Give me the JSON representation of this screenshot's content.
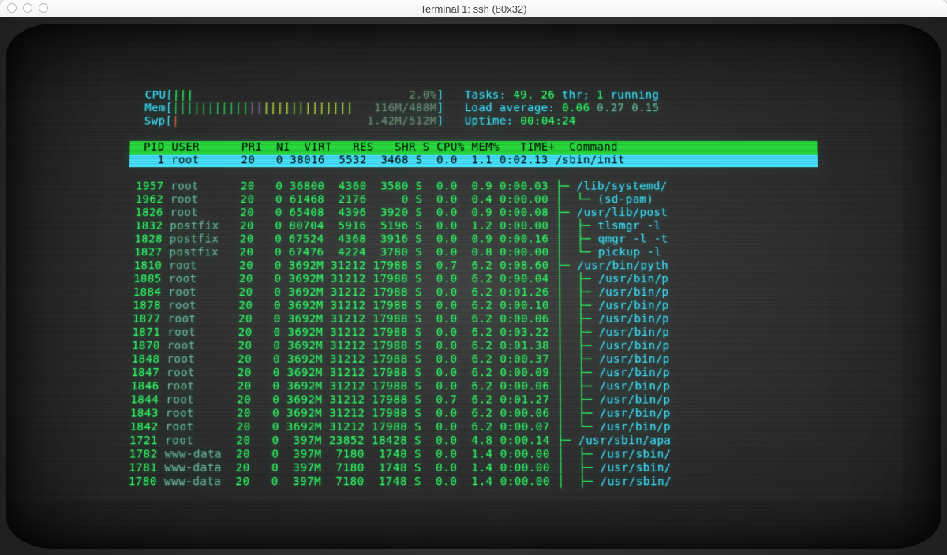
{
  "window": {
    "title": "Terminal 1: ssh (80x32)"
  },
  "meters": {
    "cpu": {
      "label": "CPU",
      "bar": "|||",
      "value": "2.0%"
    },
    "mem": {
      "label": "Mem",
      "bar": "||||||||||||||||||||||||||",
      "value": "116M/488M"
    },
    "swp": {
      "label": "Swp",
      "bar": "|",
      "value": "1.42M/512M"
    },
    "tasks": {
      "label": "Tasks:",
      "value": "49, 26 thr; 1 running"
    },
    "loadavg": {
      "label": "Load average:",
      "value": "0.06 0.27 0.15"
    },
    "uptime": {
      "label": "Uptime:",
      "value": "00:04:24"
    }
  },
  "columns": "  PID USER      PRI  NI  VIRT   RES   SHR S CPU% MEM%   TIME+  Command",
  "selected": {
    "pid": "1",
    "user": "root",
    "pri": "20",
    "ni": "0",
    "virt": "38016",
    "res": "5532",
    "shr": "3468",
    "s": "S",
    "cpu": "0.0",
    "mem": "1.1",
    "time": "0:02.13",
    "cmd": "/sbin/init"
  },
  "rows": [
    {
      "pid": "1957",
      "user": "root",
      "pri": "20",
      "ni": "0",
      "virt": "36800",
      "res": "4360",
      "shr": "3580",
      "s": "S",
      "cpu": "0.0",
      "mem": "0.9",
      "time": "0:00.03",
      "tree": "├─ ",
      "cmd": "/lib/systemd/"
    },
    {
      "pid": "1962",
      "user": "root",
      "pri": "20",
      "ni": "0",
      "virt": "61468",
      "res": "2176",
      "shr": "0",
      "s": "S",
      "cpu": "0.0",
      "mem": "0.4",
      "time": "0:00.00",
      "tree": "│  └─ ",
      "cmd": "(sd-pam)"
    },
    {
      "pid": "1826",
      "user": "root",
      "pri": "20",
      "ni": "0",
      "virt": "65408",
      "res": "4396",
      "shr": "3920",
      "s": "S",
      "cpu": "0.0",
      "mem": "0.9",
      "time": "0:00.08",
      "tree": "├─ ",
      "cmd": "/usr/lib/post"
    },
    {
      "pid": "1832",
      "user": "postfix",
      "pri": "20",
      "ni": "0",
      "virt": "80704",
      "res": "5916",
      "shr": "5196",
      "s": "S",
      "cpu": "0.0",
      "mem": "1.2",
      "time": "0:00.00",
      "tree": "│  ├─ ",
      "cmd": "tlsmgr -l"
    },
    {
      "pid": "1828",
      "user": "postfix",
      "pri": "20",
      "ni": "0",
      "virt": "67524",
      "res": "4368",
      "shr": "3916",
      "s": "S",
      "cpu": "0.0",
      "mem": "0.9",
      "time": "0:00.16",
      "tree": "│  ├─ ",
      "cmd": "qmgr -l -t"
    },
    {
      "pid": "1827",
      "user": "postfix",
      "pri": "20",
      "ni": "0",
      "virt": "67476",
      "res": "4224",
      "shr": "3780",
      "s": "S",
      "cpu": "0.0",
      "mem": "0.8",
      "time": "0:00.00",
      "tree": "│  └─ ",
      "cmd": "pickup -l"
    },
    {
      "pid": "1810",
      "user": "root",
      "pri": "20",
      "ni": "0",
      "virt": "3692M",
      "res": "31212",
      "shr": "17988",
      "s": "S",
      "cpu": "0.7",
      "mem": "6.2",
      "time": "0:08.60",
      "tree": "├─ ",
      "cmd": "/usr/bin/pyth"
    },
    {
      "pid": "1885",
      "user": "root",
      "pri": "20",
      "ni": "0",
      "virt": "3692M",
      "res": "31212",
      "shr": "17988",
      "s": "S",
      "cpu": "0.0",
      "mem": "6.2",
      "time": "0:00.04",
      "tree": "│  ├─ ",
      "cmd": "/usr/bin/p"
    },
    {
      "pid": "1884",
      "user": "root",
      "pri": "20",
      "ni": "0",
      "virt": "3692M",
      "res": "31212",
      "shr": "17988",
      "s": "S",
      "cpu": "0.0",
      "mem": "6.2",
      "time": "0:01.26",
      "tree": "│  ├─ ",
      "cmd": "/usr/bin/p"
    },
    {
      "pid": "1878",
      "user": "root",
      "pri": "20",
      "ni": "0",
      "virt": "3692M",
      "res": "31212",
      "shr": "17988",
      "s": "S",
      "cpu": "0.0",
      "mem": "6.2",
      "time": "0:00.10",
      "tree": "│  ├─ ",
      "cmd": "/usr/bin/p"
    },
    {
      "pid": "1877",
      "user": "root",
      "pri": "20",
      "ni": "0",
      "virt": "3692M",
      "res": "31212",
      "shr": "17988",
      "s": "S",
      "cpu": "0.0",
      "mem": "6.2",
      "time": "0:00.06",
      "tree": "│  ├─ ",
      "cmd": "/usr/bin/p"
    },
    {
      "pid": "1871",
      "user": "root",
      "pri": "20",
      "ni": "0",
      "virt": "3692M",
      "res": "31212",
      "shr": "17988",
      "s": "S",
      "cpu": "0.0",
      "mem": "6.2",
      "time": "0:03.22",
      "tree": "│  ├─ ",
      "cmd": "/usr/bin/p"
    },
    {
      "pid": "1870",
      "user": "root",
      "pri": "20",
      "ni": "0",
      "virt": "3692M",
      "res": "31212",
      "shr": "17988",
      "s": "S",
      "cpu": "0.0",
      "mem": "6.2",
      "time": "0:01.38",
      "tree": "│  ├─ ",
      "cmd": "/usr/bin/p"
    },
    {
      "pid": "1848",
      "user": "root",
      "pri": "20",
      "ni": "0",
      "virt": "3692M",
      "res": "31212",
      "shr": "17988",
      "s": "S",
      "cpu": "0.0",
      "mem": "6.2",
      "time": "0:00.37",
      "tree": "│  ├─ ",
      "cmd": "/usr/bin/p"
    },
    {
      "pid": "1847",
      "user": "root",
      "pri": "20",
      "ni": "0",
      "virt": "3692M",
      "res": "31212",
      "shr": "17988",
      "s": "S",
      "cpu": "0.0",
      "mem": "6.2",
      "time": "0:00.09",
      "tree": "│  ├─ ",
      "cmd": "/usr/bin/p"
    },
    {
      "pid": "1846",
      "user": "root",
      "pri": "20",
      "ni": "0",
      "virt": "3692M",
      "res": "31212",
      "shr": "17988",
      "s": "S",
      "cpu": "0.0",
      "mem": "6.2",
      "time": "0:00.06",
      "tree": "│  ├─ ",
      "cmd": "/usr/bin/p"
    },
    {
      "pid": "1844",
      "user": "root",
      "pri": "20",
      "ni": "0",
      "virt": "3692M",
      "res": "31212",
      "shr": "17988",
      "s": "S",
      "cpu": "0.7",
      "mem": "6.2",
      "time": "0:01.27",
      "tree": "│  ├─ ",
      "cmd": "/usr/bin/p"
    },
    {
      "pid": "1843",
      "user": "root",
      "pri": "20",
      "ni": "0",
      "virt": "3692M",
      "res": "31212",
      "shr": "17988",
      "s": "S",
      "cpu": "0.0",
      "mem": "6.2",
      "time": "0:00.06",
      "tree": "│  ├─ ",
      "cmd": "/usr/bin/p"
    },
    {
      "pid": "1842",
      "user": "root",
      "pri": "20",
      "ni": "0",
      "virt": "3692M",
      "res": "31212",
      "shr": "17988",
      "s": "S",
      "cpu": "0.0",
      "mem": "6.2",
      "time": "0:00.07",
      "tree": "│  └─ ",
      "cmd": "/usr/bin/p"
    },
    {
      "pid": "1721",
      "user": "root",
      "pri": "20",
      "ni": "0",
      "virt": "397M",
      "res": "23852",
      "shr": "18428",
      "s": "S",
      "cpu": "0.0",
      "mem": "4.8",
      "time": "0:00.14",
      "tree": "├─ ",
      "cmd": "/usr/sbin/apa"
    },
    {
      "pid": "1782",
      "user": "www-data",
      "pri": "20",
      "ni": "0",
      "virt": "397M",
      "res": "7180",
      "shr": "1748",
      "s": "S",
      "cpu": "0.0",
      "mem": "1.4",
      "time": "0:00.00",
      "tree": "│  ├─ ",
      "cmd": "/usr/sbin/"
    },
    {
      "pid": "1781",
      "user": "www-data",
      "pri": "20",
      "ni": "0",
      "virt": "397M",
      "res": "7180",
      "shr": "1748",
      "s": "S",
      "cpu": "0.0",
      "mem": "1.4",
      "time": "0:00.00",
      "tree": "│  ├─ ",
      "cmd": "/usr/sbin/"
    },
    {
      "pid": "1780",
      "user": "www-data",
      "pri": "20",
      "ni": "0",
      "virt": "397M",
      "res": "7180",
      "shr": "1748",
      "s": "S",
      "cpu": "0.0",
      "mem": "1.4",
      "time": "0:00.00",
      "tree": "│  ├─ ",
      "cmd": "/usr/sbin/"
    }
  ]
}
